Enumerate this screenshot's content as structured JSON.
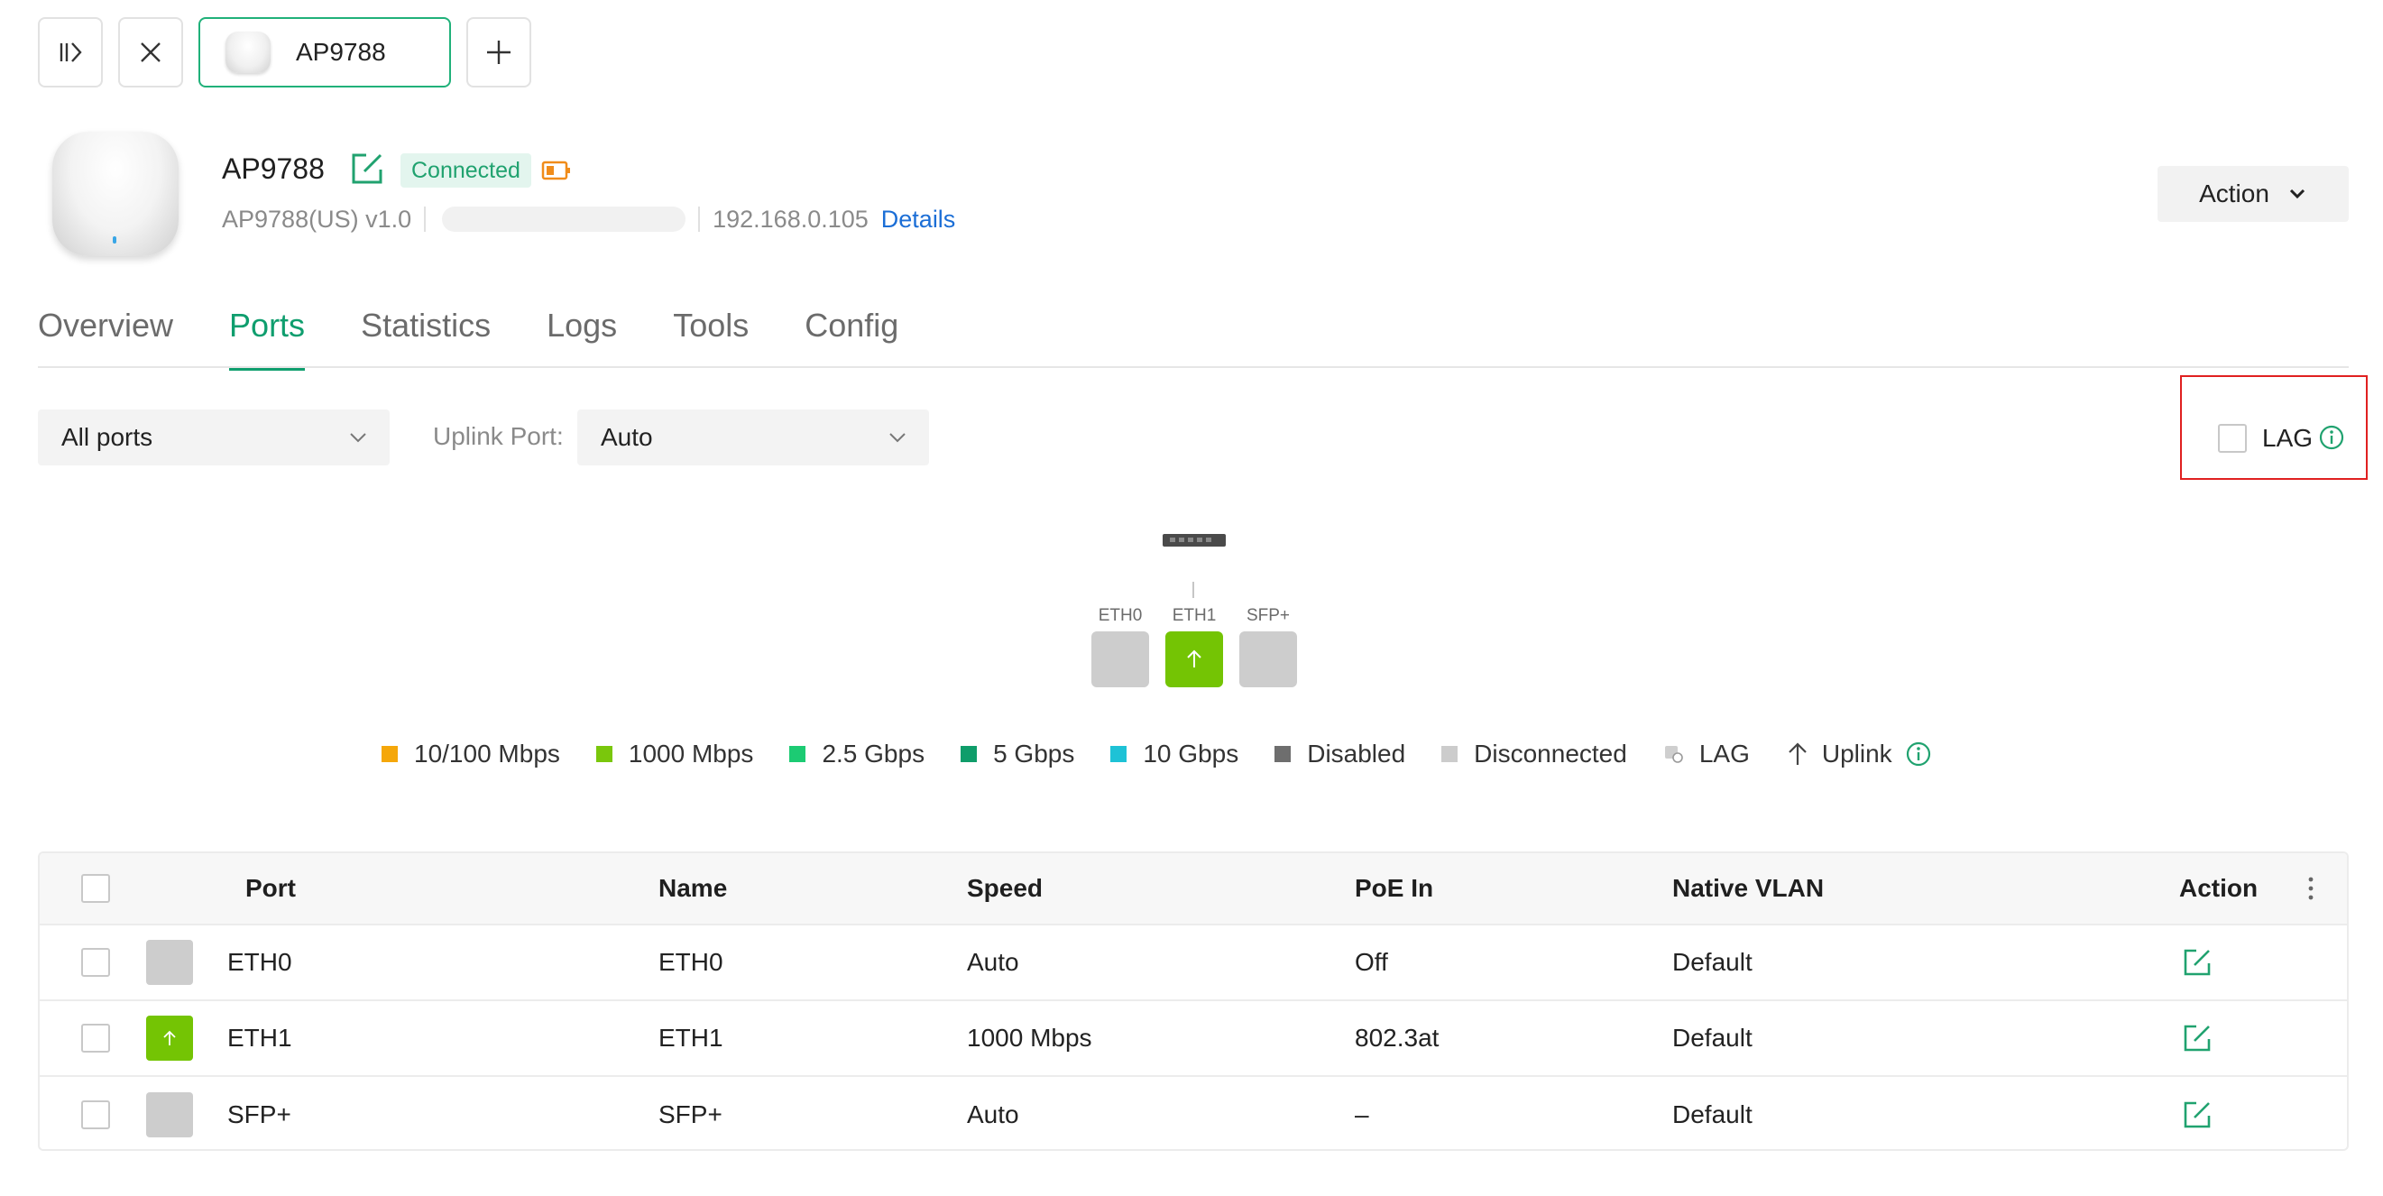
{
  "topbar": {
    "tab_label": "AP9788"
  },
  "device": {
    "name": "AP9788",
    "status": "Connected",
    "model": "AP9788(US) v1.0",
    "ip": "192.168.0.105",
    "details_link": "Details",
    "action_label": "Action"
  },
  "tabs": [
    "Overview",
    "Ports",
    "Statistics",
    "Logs",
    "Tools",
    "Config"
  ],
  "active_tab": "Ports",
  "filters": {
    "ports_select": "All ports",
    "uplink_label": "Uplink Port:",
    "uplink_select": "Auto",
    "lag_label": "LAG",
    "lag_checked": false
  },
  "diagram": {
    "ports": [
      {
        "label": "ETH0",
        "state": "disconnected"
      },
      {
        "label": "ETH1",
        "state": "uplink-1000"
      },
      {
        "label": "SFP+",
        "state": "disconnected"
      }
    ]
  },
  "legend": [
    {
      "label": "10/100 Mbps",
      "color": "#f5a70a"
    },
    {
      "label": "1000 Mbps",
      "color": "#7ac70c"
    },
    {
      "label": "2.5 Gbps",
      "color": "#1ccb73"
    },
    {
      "label": "5 Gbps",
      "color": "#0f9d6a"
    },
    {
      "label": "10 Gbps",
      "color": "#1ec2d6"
    },
    {
      "label": "Disabled",
      "color": "#6e6e6e"
    },
    {
      "label": "Disconnected",
      "color": "#cccccc"
    },
    {
      "label": "LAG",
      "icon": "lag-icon"
    },
    {
      "label": "Uplink",
      "icon": "uplink-arrow-icon"
    }
  ],
  "table": {
    "headers": {
      "port": "Port",
      "name": "Name",
      "speed": "Speed",
      "poe": "PoE In",
      "vlan": "Native VLAN",
      "action": "Action"
    },
    "rows": [
      {
        "port": "ETH0",
        "name": "ETH0",
        "speed": "Auto",
        "poe": "Off",
        "vlan": "Default"
      },
      {
        "port": "ETH1",
        "name": "ETH1",
        "speed": "1000 Mbps",
        "poe": "802.3at",
        "vlan": "Default"
      },
      {
        "port": "SFP+",
        "name": "SFP+",
        "speed": "Auto",
        "poe": "–",
        "vlan": "Default"
      }
    ]
  },
  "colors": {
    "accent": "#0f9e6e",
    "link": "#1b6ed6",
    "port_active": "#74c404",
    "port_inactive": "#cdcdcd",
    "highlight_box": "#e02020"
  }
}
